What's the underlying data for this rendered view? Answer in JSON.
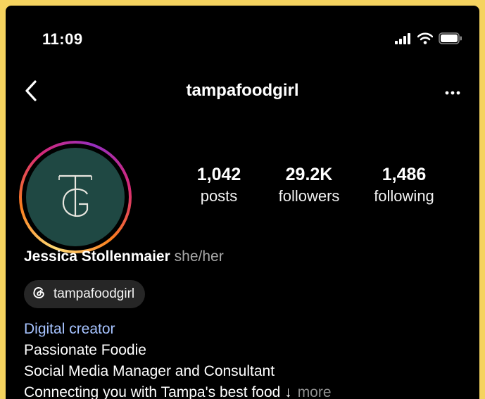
{
  "status_bar": {
    "time": "11:09",
    "icons": [
      "cellular-signal-icon",
      "wifi-icon",
      "battery-icon"
    ]
  },
  "nav": {
    "username": "tampafoodgirl",
    "back_icon": "chevron-left-icon",
    "more_icon": "ellipsis-icon"
  },
  "profile": {
    "avatar_initials": "TG",
    "avatar_color": "#1f4843",
    "stats": [
      {
        "value": "1,042",
        "label": "posts"
      },
      {
        "value": "29.2K",
        "label": "followers"
      },
      {
        "value": "1,486",
        "label": "following"
      }
    ],
    "name": "Jessica Stollenmaier",
    "pronouns": "she/her",
    "threads_handle": "tampafoodgirl",
    "bio": {
      "category": "Digital creator",
      "lines": [
        "Passionate Foodie",
        "Social Media Manager and Consultant",
        "Connecting you with Tampa's best food ↓"
      ],
      "more_label": "more"
    }
  },
  "colors": {
    "page_background": "#f5d35f",
    "app_background": "#000000",
    "link": "#a6c3ff",
    "secondary_text": "#a8a8a8",
    "chip": "#262626"
  }
}
